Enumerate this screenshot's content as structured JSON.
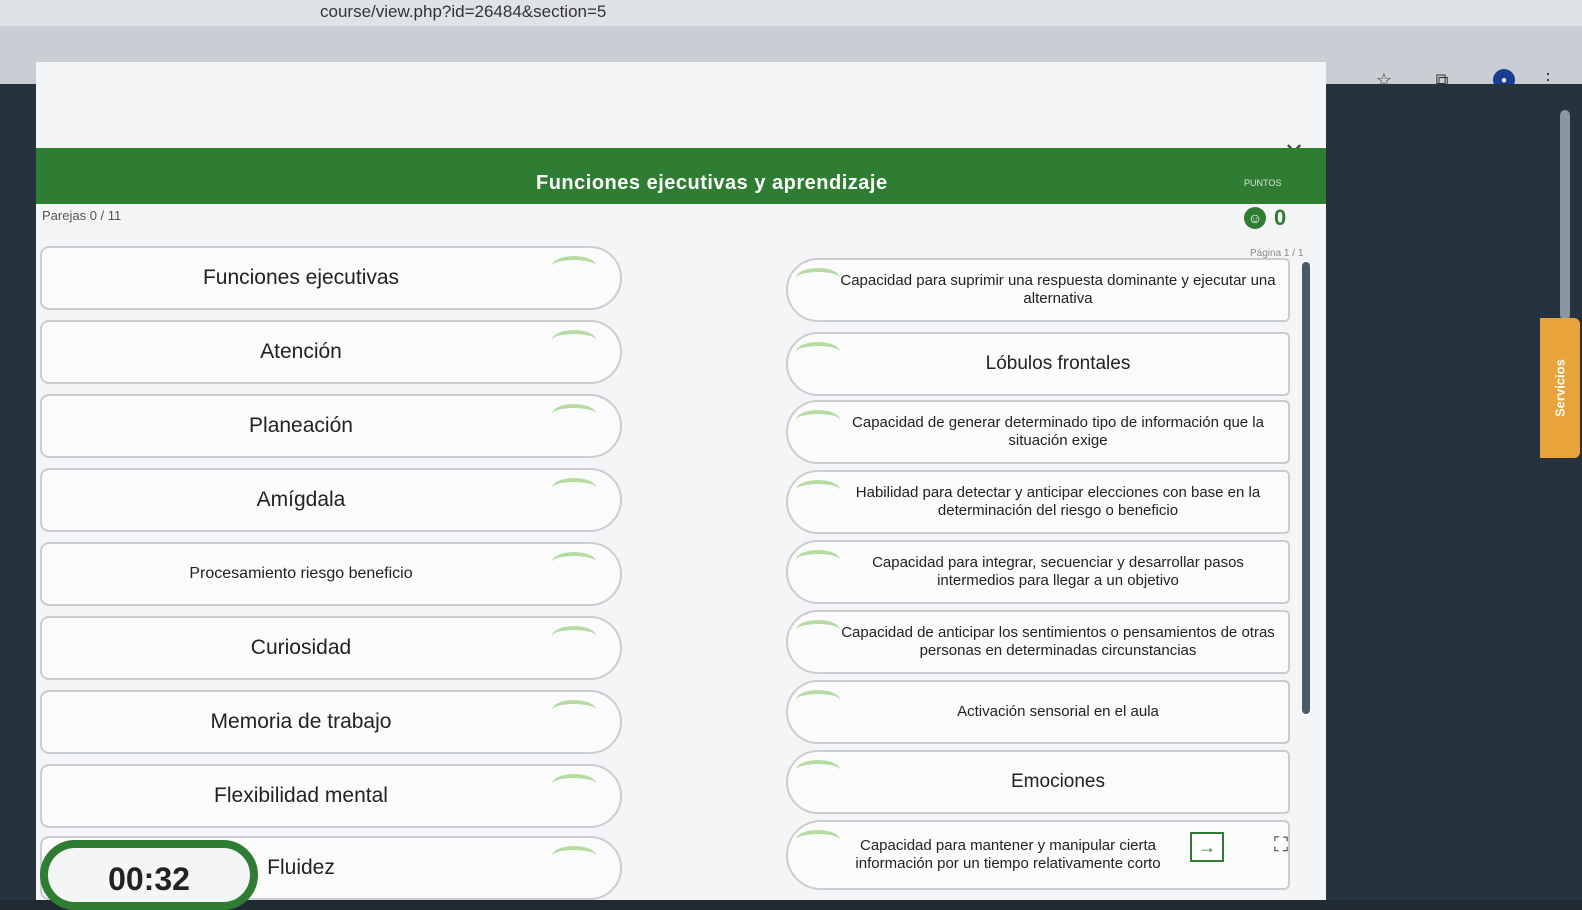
{
  "browser": {
    "url": "course/view.php?id=26484&section=5"
  },
  "side_tab": {
    "label": "Servicios"
  },
  "activity": {
    "title": "Funciones ejecutivas y aprendizaje",
    "pairs_label": "Parejas 0 / 11",
    "points_label": "PUNTOS",
    "score": "0",
    "page_label": "Página 1 / 1",
    "timer": "00:32"
  },
  "left_cards": [
    "Funciones ejecutivas",
    "Atención",
    "Planeación",
    "Amígdala",
    "Procesamiento riesgo beneficio",
    "Curiosidad",
    "Memoria de trabajo",
    "Flexibilidad mental",
    "Fluidez"
  ],
  "right_cards": [
    "Capacidad para suprimir una respuesta dominante y ejecutar una alternativa",
    "Lóbulos frontales",
    "Capacidad de generar determinado tipo de información que la situación exige",
    "Habilidad para detectar y anticipar elecciones con base en la determinación del riesgo o beneficio",
    "Capacidad para integrar, secuenciar y desarrollar pasos intermedios para llegar a un objetivo",
    "Capacidad de anticipar los sentimientos o pensamientos de otras personas en determinadas circunstancias",
    "Activación sensorial en el aula",
    "Emociones",
    "Capacidad para mantener y manipular cierta información por un tiempo relativamente corto"
  ],
  "icons": {
    "close": "close-icon",
    "star": "star-icon",
    "extension": "extension-icon",
    "menu": "kebab-menu-icon",
    "fullscreen": "fullscreen-icon"
  },
  "colors": {
    "accent_green": "#2f7d32",
    "side_tab": "#e8a33a"
  }
}
